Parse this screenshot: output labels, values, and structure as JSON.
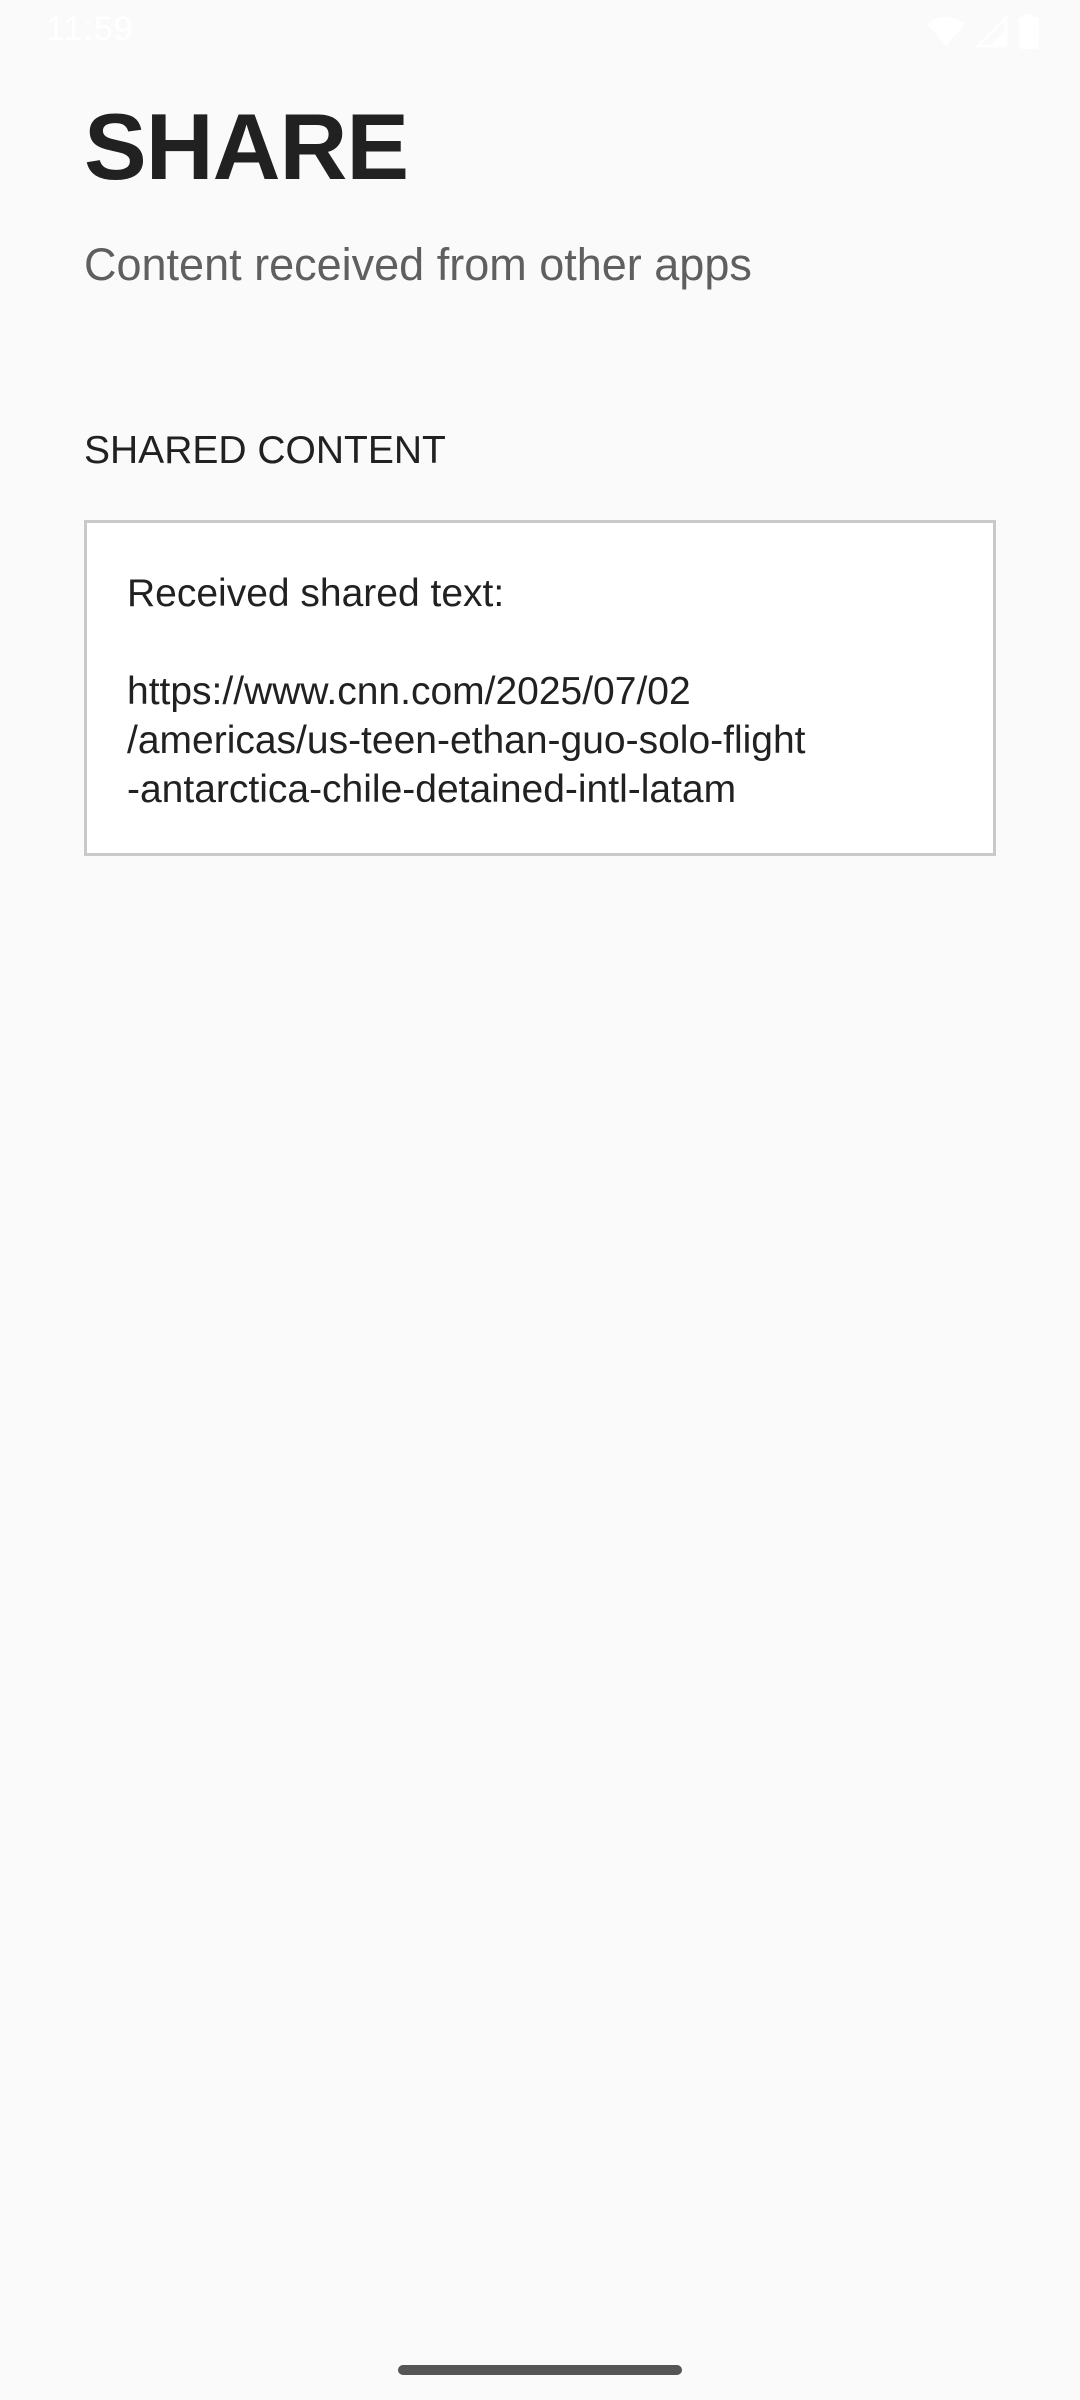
{
  "status_bar": {
    "time": "11:59",
    "icons": [
      "wifi-icon",
      "signal-icon",
      "battery-icon"
    ]
  },
  "header": {
    "title": "SHARE",
    "subtitle": "Content received from other apps"
  },
  "shared_section": {
    "label": "SHARED CONTENT",
    "heading": "Received shared text:",
    "url": "https://www.cnn.com/2025/07/02\n/americas/us-teen-ethan-guo-solo-flight\n-antarctica-chile-detained-intl-latam"
  },
  "colors": {
    "background": "#fafafa",
    "title": "#212121",
    "subtitle": "#5f5f5f",
    "box_border": "#c9c9c9"
  }
}
